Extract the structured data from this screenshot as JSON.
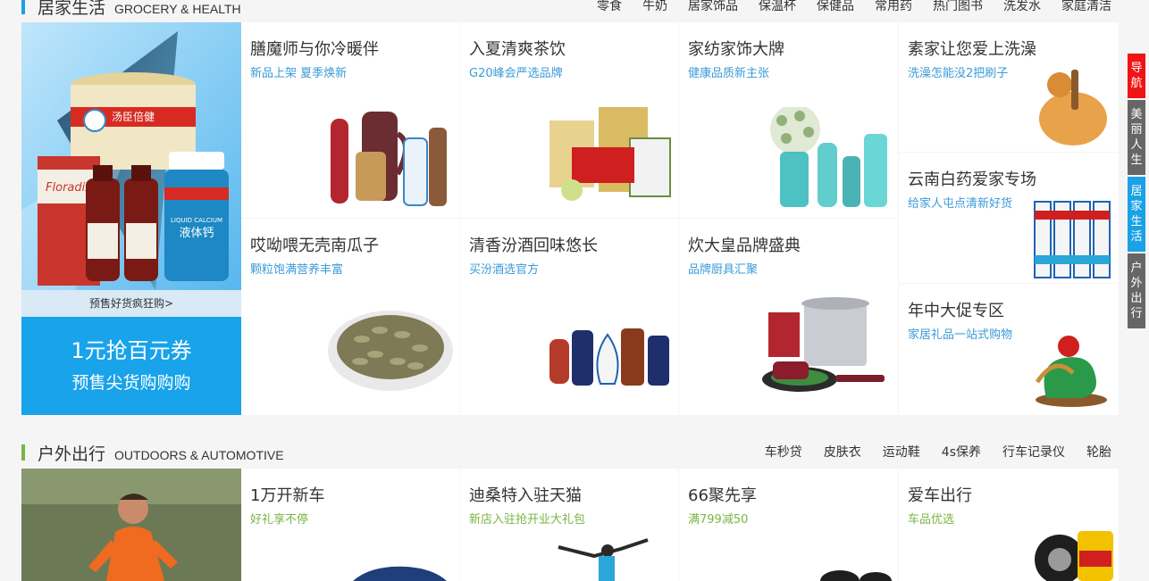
{
  "colors": {
    "grocery_accent": "#1aa1e6",
    "outdoor_accent": "#79b543",
    "sidenav_active": "#f01414",
    "sidenav_inactive": "#666666",
    "sidenav_current": "#1aa1e6"
  },
  "grocery": {
    "title": "居家生活",
    "title_en": "GROCERY & HEALTH",
    "nav": [
      "零食",
      "牛奶",
      "居家饰品",
      "保温杯",
      "保健品",
      "常用药",
      "热门图书",
      "洗发水",
      "家庭清洁"
    ],
    "banner": {
      "prod_brand_text": "汤臣倍健",
      "prod_floradix": "Floradix",
      "prod_calcium_en": "LIQUID CALCIUM",
      "prod_calcium_cn": "液体钙",
      "caption": "预售好货疯狂购>",
      "promo_line1": "1元抢百元券",
      "promo_line2": "预售尖货购购购"
    },
    "tiles": [
      {
        "title": "膳魔师与你冷暖伴",
        "sub": "新品上架 夏季焕新"
      },
      {
        "title": "入夏清爽茶饮",
        "sub": "G20峰会严选品牌"
      },
      {
        "title": "家纺家饰大牌",
        "sub": "健康品质新主张"
      },
      {
        "title": "哎呦喂无壳南瓜子",
        "sub": "颗粒饱满营养丰富"
      },
      {
        "title": "清香汾酒回味悠长",
        "sub": "买汾酒选官方"
      },
      {
        "title": "炊大皇品牌盛典",
        "sub": "品牌厨具汇聚"
      },
      {
        "title": "素家让您爱上洗澡",
        "sub": "洗澡怎能没2把刷子"
      },
      {
        "title": "云南白药爱家专场",
        "sub": "给家人屯点清新好货"
      },
      {
        "title": "年中大促专区",
        "sub": "家居礼品一站式购物"
      }
    ]
  },
  "outdoor": {
    "title": "户外出行",
    "title_en": "OUTDOORS & AUTOMOTIVE",
    "nav": [
      "车秒贷",
      "皮肤衣",
      "运动鞋",
      "4s保养",
      "行车记录仪",
      "轮胎"
    ],
    "tiles": [
      {
        "title": "1万开新车",
        "sub": "好礼享不停"
      },
      {
        "title": "迪桑特入驻天猫",
        "sub": "新店入驻抢开业大礼包"
      },
      {
        "title": "66聚先享",
        "sub": "满799减50"
      },
      {
        "title": "爱车出行",
        "sub": "车品优选"
      }
    ]
  },
  "sidenav": [
    "导航",
    "美丽人生",
    "居家生活",
    "户外出行"
  ]
}
